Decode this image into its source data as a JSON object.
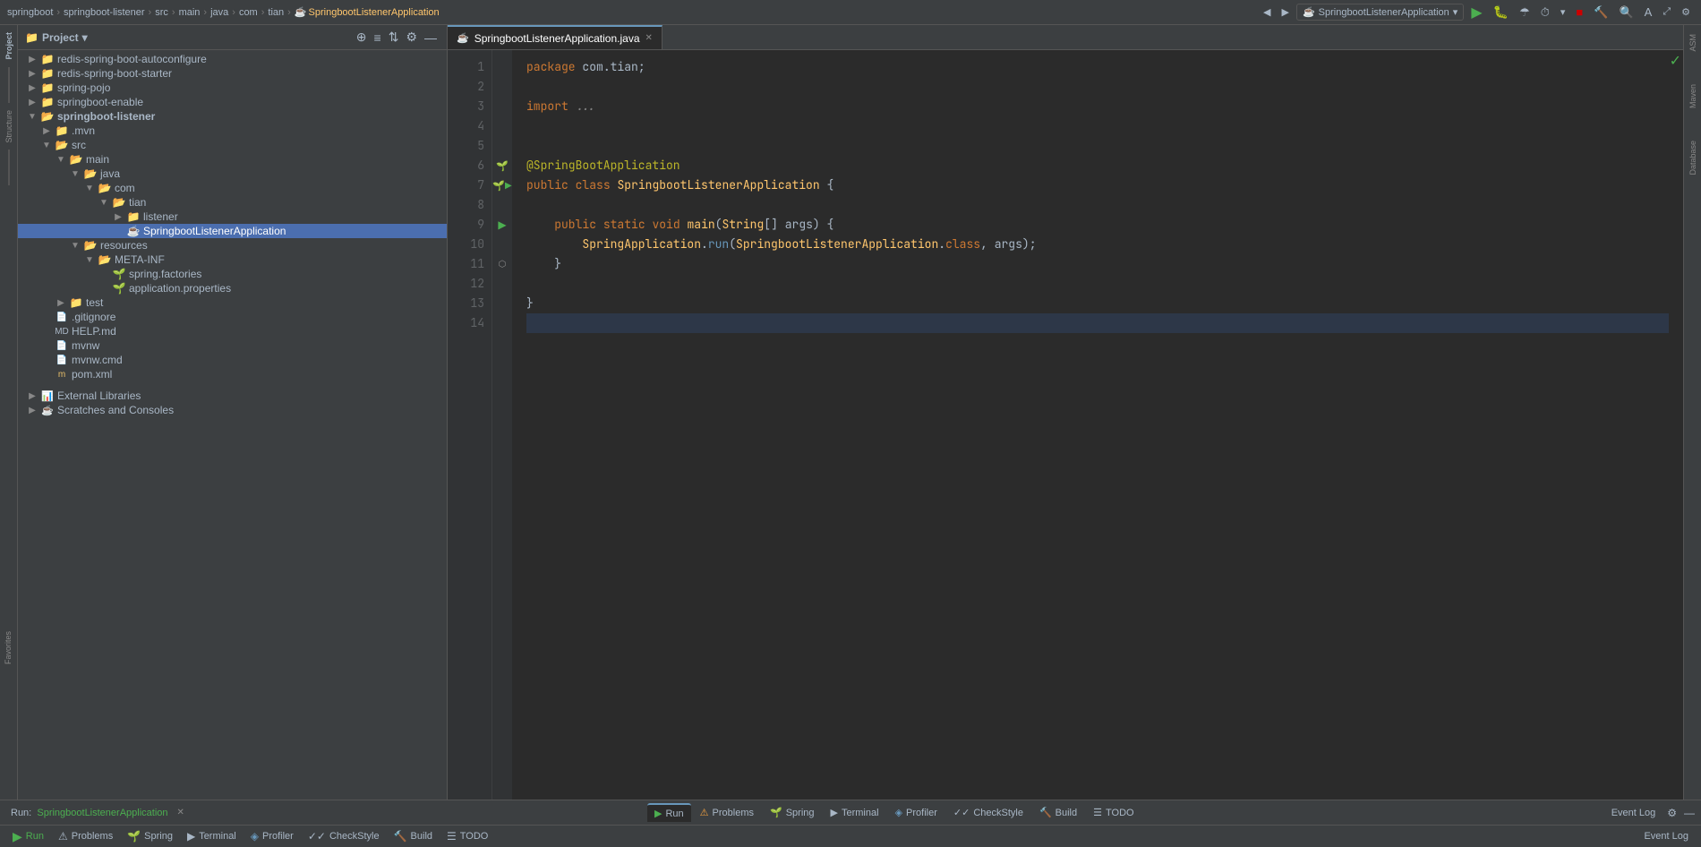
{
  "breadcrumb": {
    "items": [
      "springboot",
      "springboot-listener",
      "src",
      "main",
      "java",
      "com",
      "tian",
      "SpringbootListenerApplication"
    ],
    "separators": [
      "▶",
      "▶",
      "▶",
      "▶",
      "▶",
      "▶",
      "▶"
    ]
  },
  "toolbar": {
    "run_config": "SpringbootListenerApplication",
    "buttons": [
      "back",
      "forward",
      "run",
      "debug",
      "coverage",
      "profile",
      "stop",
      "build",
      "search",
      "translate",
      "expand",
      "settings"
    ]
  },
  "project_panel": {
    "title": "Project",
    "items": [
      {
        "level": 0,
        "type": "folder",
        "collapsed": true,
        "name": "redis-spring-boot-autoconfigure"
      },
      {
        "level": 0,
        "type": "folder",
        "collapsed": true,
        "name": "redis-spring-boot-starter"
      },
      {
        "level": 0,
        "type": "folder",
        "collapsed": true,
        "name": "spring-pojo"
      },
      {
        "level": 0,
        "type": "folder",
        "collapsed": true,
        "name": "springboot-enable"
      },
      {
        "level": 0,
        "type": "folder",
        "collapsed": false,
        "name": "springboot-listener"
      },
      {
        "level": 1,
        "type": "folder",
        "collapsed": true,
        "name": ".mvn"
      },
      {
        "level": 1,
        "type": "folder",
        "collapsed": false,
        "name": "src"
      },
      {
        "level": 2,
        "type": "folder",
        "collapsed": false,
        "name": "main"
      },
      {
        "level": 3,
        "type": "folder",
        "collapsed": false,
        "name": "java"
      },
      {
        "level": 4,
        "type": "folder",
        "collapsed": false,
        "name": "com"
      },
      {
        "level": 5,
        "type": "folder",
        "collapsed": false,
        "name": "tian"
      },
      {
        "level": 6,
        "type": "folder",
        "collapsed": true,
        "name": "listener"
      },
      {
        "level": 6,
        "type": "java",
        "collapsed": false,
        "name": "SpringbootListenerApplication",
        "selected": true
      },
      {
        "level": 3,
        "type": "folder",
        "collapsed": false,
        "name": "resources"
      },
      {
        "level": 4,
        "type": "folder",
        "collapsed": false,
        "name": "META-INF"
      },
      {
        "level": 5,
        "type": "spring",
        "name": "spring.factories"
      },
      {
        "level": 5,
        "type": "properties",
        "name": "application.properties"
      },
      {
        "level": 2,
        "type": "folder",
        "collapsed": true,
        "name": "test"
      },
      {
        "level": 1,
        "type": "gitignore",
        "name": ".gitignore"
      },
      {
        "level": 1,
        "type": "md",
        "name": "HELP.md"
      },
      {
        "level": 1,
        "type": "file",
        "name": "mvnw"
      },
      {
        "level": 1,
        "type": "file",
        "name": "mvnw.cmd"
      },
      {
        "level": 1,
        "type": "xml",
        "name": "pom.xml"
      }
    ],
    "footer": [
      {
        "name": "External Libraries",
        "collapsed": true
      },
      {
        "name": "Scratches and Consoles",
        "collapsed": true
      }
    ]
  },
  "editor": {
    "tab": "SpringbootListenerApplication.java",
    "lines": [
      {
        "num": 1,
        "code": "package_com_tian"
      },
      {
        "num": 2,
        "code": "empty"
      },
      {
        "num": 3,
        "code": "import_dots"
      },
      {
        "num": 4,
        "code": "empty"
      },
      {
        "num": 5,
        "code": "empty"
      },
      {
        "num": 6,
        "code": "annotation"
      },
      {
        "num": 7,
        "code": "class_decl"
      },
      {
        "num": 8,
        "code": "empty"
      },
      {
        "num": 9,
        "code": "main_method"
      },
      {
        "num": 10,
        "code": "run_call"
      },
      {
        "num": 11,
        "code": "close_brace_inner"
      },
      {
        "num": 12,
        "code": "empty"
      },
      {
        "num": 13,
        "code": "close_brace_outer"
      },
      {
        "num": 14,
        "code": "empty"
      }
    ]
  },
  "bottom_panel": {
    "run_label": "Run:",
    "run_app": "SpringbootListenerApplication",
    "tabs": [
      {
        "label": "Run",
        "icon": "▶",
        "active": true
      },
      {
        "label": "Problems",
        "icon": "⚠"
      },
      {
        "label": "Spring",
        "icon": "🌱"
      },
      {
        "label": "Terminal",
        "icon": "▶"
      },
      {
        "label": "Profiler",
        "icon": "📊"
      },
      {
        "label": "CheckStyle",
        "icon": "✓"
      },
      {
        "label": "Build",
        "icon": "🔨"
      },
      {
        "label": "TODO",
        "icon": "☰"
      }
    ],
    "right_tabs": [
      "Event Log"
    ]
  },
  "right_sidebar": {
    "items": [
      "ASM",
      "Maven",
      "Database"
    ]
  },
  "status": {
    "checkmark": "✓"
  }
}
